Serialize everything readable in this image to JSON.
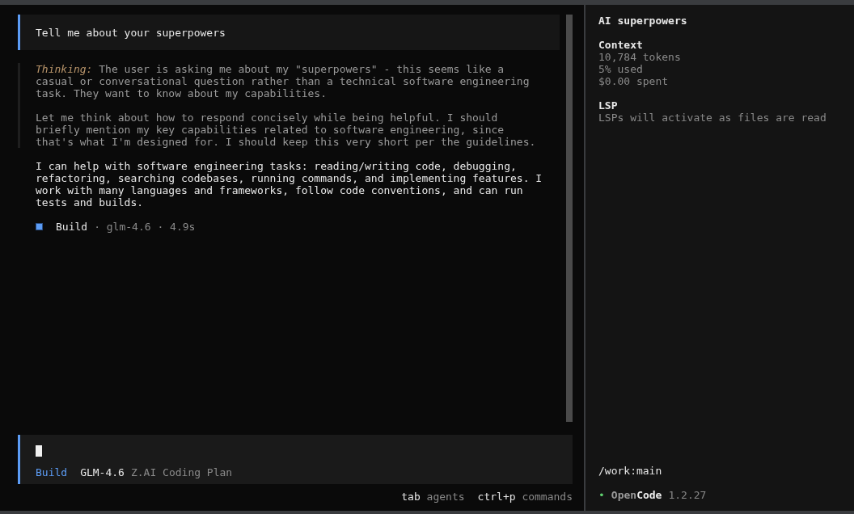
{
  "chat": {
    "prompt": "Tell me about your superpowers",
    "thinking": {
      "label": "Thinking:",
      "paragraphs": [
        "The user is asking me about my \"superpowers\" - this seems like a\ncasual or conversational question rather than a technical software engineering\ntask. They want to know about my capabilities.",
        "Let me think about how to respond concisely while being helpful. I should\nbriefly mention my key capabilities related to software engineering, since\nthat's what I'm designed for. I should keep this very short per the guidelines."
      ]
    },
    "answer": "I can help with software engineering tasks: reading/writing code, debugging,\nrefactoring, searching codebases, running commands, and implementing features. I\nwork with many languages and frameworks, follow code conventions, and can run\ntests and builds.",
    "meta": {
      "agent": "Build",
      "separator": "·",
      "model": "glm-4.6",
      "duration": "4.9s"
    }
  },
  "input": {
    "agent": "Build",
    "model": "GLM-4.6",
    "provider": "Z.AI Coding Plan"
  },
  "shortcuts": [
    {
      "key": "tab",
      "action": "agents"
    },
    {
      "key": "ctrl+p",
      "action": "commands"
    }
  ],
  "sidebar": {
    "title": "AI superpowers",
    "sections": [
      {
        "heading": "Context",
        "lines": [
          "10,784 tokens",
          "5% used",
          "$0.00 spent"
        ]
      },
      {
        "heading": "LSP",
        "lines": [
          "LSPs will activate as files are read"
        ]
      }
    ],
    "path": "/work:main",
    "status_mark": "•",
    "brand_dim": "Open",
    "brand_bright": "Code",
    "version": "1.2.27"
  }
}
